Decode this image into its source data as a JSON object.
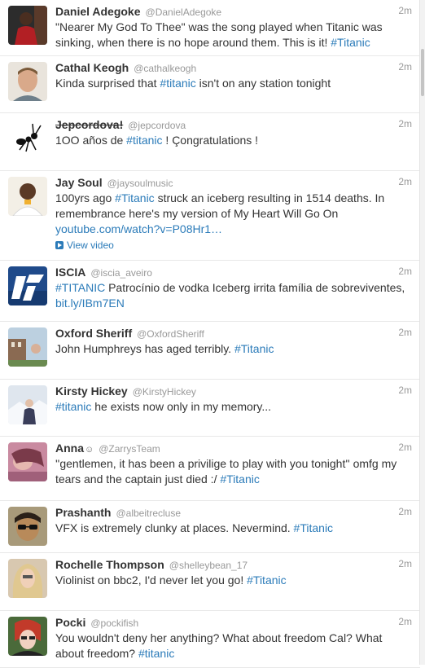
{
  "tweets": [
    {
      "name": "Daniel Adegoke",
      "handle": "@DanielAdegoke",
      "time": "2m",
      "parts": [
        {
          "t": "\"Nearer My God To Thee\" was the song played when Titanic was sinking, when there is no hope around them. This is it! "
        },
        {
          "t": "#Titanic",
          "k": "tag"
        }
      ],
      "avatar": "photo-man-red-shirt"
    },
    {
      "name": "Cathal Keogh",
      "handle": "@cathalkeogh",
      "time": "2m",
      "parts": [
        {
          "t": "Kinda surprised that "
        },
        {
          "t": "#titanic",
          "k": "tag"
        },
        {
          "t": " isn't on any station tonight"
        }
      ],
      "avatar": "photo-man-smiling"
    },
    {
      "name": "Jepcordova!",
      "handle": "@jepcordova",
      "time": "2m",
      "strike": true,
      "parts": [
        {
          "t": "1OO años de "
        },
        {
          "t": "#titanic",
          "k": "tag"
        },
        {
          "t": " ! Çongratulations !"
        }
      ],
      "avatar": "ant-drawing"
    },
    {
      "name": "Jay Soul",
      "handle": "@jaysoulmusic",
      "time": "2m",
      "parts": [
        {
          "t": "100yrs ago "
        },
        {
          "t": "#Titanic",
          "k": "tag"
        },
        {
          "t": " struck an iceberg resulting in 1514 deaths. In remembrance here's my version of My Heart Will Go On "
        },
        {
          "t": "youtube.com/watch?v=P08Hr1…",
          "k": "link"
        }
      ],
      "media": "View video",
      "avatar": "photo-man-white-shirt"
    },
    {
      "name": "ISCIA",
      "handle": "@iscia_aveiro",
      "time": "2m",
      "parts": [
        {
          "t": "#TITANIC",
          "k": "tag"
        },
        {
          "t": " Patrocínio de vodka Iceberg irrita família de sobreviventes, "
        },
        {
          "t": "bit.ly/IBm7EN",
          "k": "link"
        }
      ],
      "avatar": "iscia-logo"
    },
    {
      "name": "Oxford Sheriff",
      "handle": "@OxfordSheriff",
      "time": "2m",
      "parts": [
        {
          "t": "John Humphreys has aged terribly. "
        },
        {
          "t": "#Titanic",
          "k": "tag"
        }
      ],
      "avatar": "photo-building"
    },
    {
      "name": "Kirsty Hickey",
      "handle": "@KirstyHickey",
      "time": "2m",
      "parts": [
        {
          "t": "#titanic",
          "k": "tag"
        },
        {
          "t": " he exists now only in my memory..."
        }
      ],
      "avatar": "photo-snow"
    },
    {
      "name": "Anna",
      "name_suffix": "☺",
      "handle": "@ZarrysTeam",
      "time": "2m",
      "parts": [
        {
          "t": "''gentlemen, it has been a privilige to play with you tonight'' omfg my tears and the captain just died :/ "
        },
        {
          "t": "#Titanic",
          "k": "tag"
        }
      ],
      "avatar": "photo-girl-pink"
    },
    {
      "name": "Prashanth",
      "handle": "@albeitrecluse",
      "time": "2m",
      "parts": [
        {
          "t": "VFX is extremely clunky at places. Nevermind. "
        },
        {
          "t": "#Titanic",
          "k": "tag"
        }
      ],
      "avatar": "photo-man-sunglasses"
    },
    {
      "name": "Rochelle Thompson",
      "handle": "@shelleybean_17",
      "time": "2m",
      "parts": [
        {
          "t": "Violinist on bbc2, I'd never let you go! "
        },
        {
          "t": "#Titanic",
          "k": "tag"
        }
      ],
      "avatar": "photo-woman-blonde"
    },
    {
      "name": "Pocki",
      "handle": "@pockifish",
      "time": "2m",
      "parts": [
        {
          "t": "You wouldn't deny her anything? What about freedom Cal? What about freedom? "
        },
        {
          "t": "#titanic",
          "k": "tag"
        }
      ],
      "avatar": "photo-girl-red-hair"
    }
  ],
  "colors": {
    "link": "#2b7bb9",
    "meta": "#999999",
    "text": "#333333",
    "divider": "#e8e8e8"
  }
}
